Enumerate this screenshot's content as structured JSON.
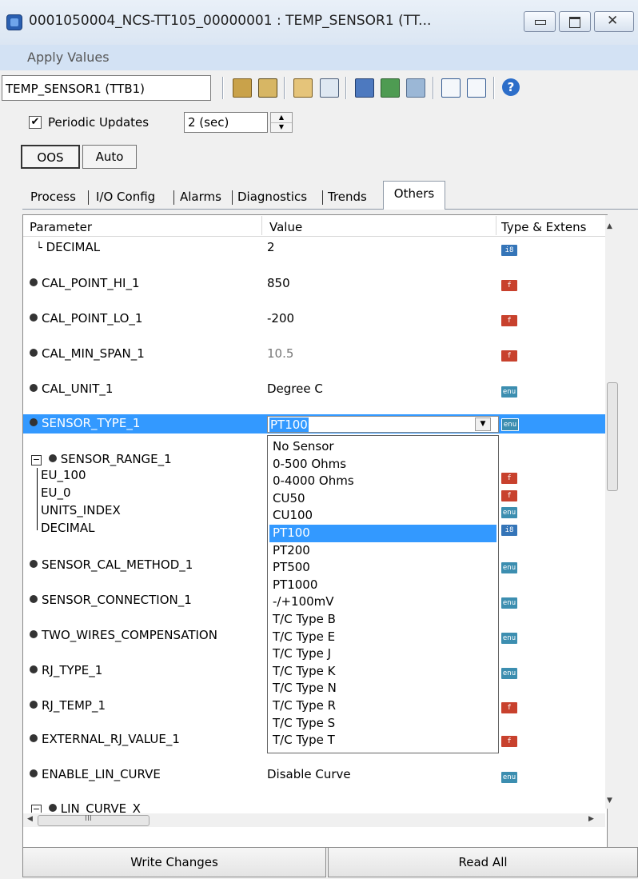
{
  "window": {
    "title": "0001050004_NCS-TT105_00000001 : TEMP_SENSOR1 (TT..."
  },
  "menu": {
    "apply_values": "Apply Values"
  },
  "toolbar": {
    "block_select": "TEMP_SENSOR1 (TTB1)"
  },
  "periodic": {
    "checked_mark": "✔",
    "label": "Periodic Updates",
    "interval": "2 (sec)"
  },
  "modes": {
    "oos": "OOS",
    "auto": "Auto"
  },
  "tabs": [
    {
      "label": "Process"
    },
    {
      "label": "I/O Config"
    },
    {
      "label": "Alarms"
    },
    {
      "label": "Diagnostics"
    },
    {
      "label": "Trends"
    },
    {
      "label": "Others"
    }
  ],
  "grid": {
    "headers": {
      "parameter": "Parameter",
      "value": "Value",
      "type": "Type & Extens"
    },
    "rows": [
      {
        "name": "DECIMAL",
        "value": "2",
        "type": "i8"
      },
      {
        "name": "CAL_POINT_HI_1",
        "value": "850",
        "type": "f"
      },
      {
        "name": "CAL_POINT_LO_1",
        "value": "-200",
        "type": "f"
      },
      {
        "name": "CAL_MIN_SPAN_1",
        "value": "10.5",
        "type": "f"
      },
      {
        "name": "CAL_UNIT_1",
        "value": "Degree C",
        "type": "enu"
      },
      {
        "name": "SENSOR_TYPE_1",
        "value": "PT100",
        "type": "enu"
      },
      {
        "name": "SENSOR_RANGE_1",
        "value": "",
        "type": ""
      },
      {
        "name": "EU_100",
        "value": "",
        "type": "f"
      },
      {
        "name": "EU_0",
        "value": "",
        "type": "f"
      },
      {
        "name": "UNITS_INDEX",
        "value": "",
        "type": "enu"
      },
      {
        "name": "DECIMAL",
        "value": "",
        "type": "i8"
      },
      {
        "name": "SENSOR_CAL_METHOD_1",
        "value": "",
        "type": "enu"
      },
      {
        "name": "SENSOR_CONNECTION_1",
        "value": "",
        "type": "enu"
      },
      {
        "name": "TWO_WIRES_COMPENSATION",
        "value": "",
        "type": "enu"
      },
      {
        "name": "RJ_TYPE_1",
        "value": "",
        "type": "enu"
      },
      {
        "name": "RJ_TEMP_1",
        "value": "",
        "type": "f"
      },
      {
        "name": "EXTERNAL_RJ_VALUE_1",
        "value": "",
        "type": "f"
      },
      {
        "name": "ENABLE_LIN_CURVE",
        "value": "Disable Curve",
        "type": "enu"
      },
      {
        "name": "LIN_CURVE_X",
        "value": "",
        "type": ""
      }
    ]
  },
  "dropdown": {
    "selected": "PT100",
    "options": [
      "No Sensor",
      "0-500 Ohms",
      "0-4000 Ohms",
      "CU50",
      "CU100",
      "PT100",
      "PT200",
      "PT500",
      "PT1000",
      "-/+100mV",
      "T/C Type B",
      "T/C Type E",
      "T/C Type J",
      "T/C Type K",
      "T/C Type N",
      "T/C Type R",
      "T/C Type S",
      "T/C Type T"
    ]
  },
  "hscroll": {
    "grip": "III"
  },
  "buttons": {
    "write": "Write Changes",
    "read": "Read All"
  },
  "colors": {
    "selection": "#3399ff",
    "menu_bg": "#d3e2f4",
    "float_badge": "#c8412d",
    "enum_badge": "#3c8eb0",
    "int_badge": "#3575b8"
  },
  "icons": [
    "app-icon",
    "minimize-icon",
    "maximize-icon",
    "close-icon",
    "edit-icon",
    "edit-all-icon",
    "block-icon",
    "chart-icon",
    "download-icon",
    "transfer-icon",
    "arrows-icon",
    "list-view-icon",
    "table-view-icon",
    "help-icon",
    "checkbox-icon",
    "spin-up-icon",
    "spin-down-icon",
    "dropdown-arrow-icon",
    "scroll-up-icon",
    "scroll-down-icon",
    "scroll-left-icon",
    "scroll-right-icon",
    "collapse-icon"
  ]
}
